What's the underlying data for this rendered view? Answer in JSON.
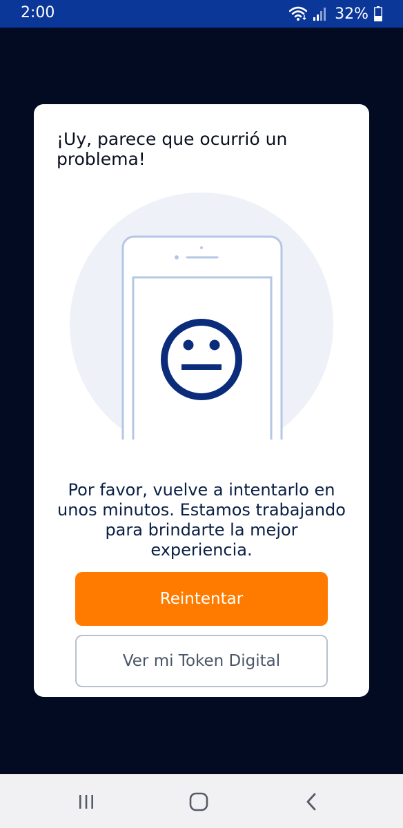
{
  "status_bar": {
    "time": "2:00",
    "battery_percent": "32%",
    "icons": [
      "wifi-icon",
      "signal-icon",
      "battery-icon"
    ]
  },
  "dialog": {
    "title": "¡Uy, parece que ocurrió un problema!",
    "illustration": "phone-neutral-face",
    "message": "Por favor, vuelve a intentarlo en unos minutos. Estamos trabajando para brindarte la mejor experiencia.",
    "primary_button": "Reintentar",
    "secondary_button": "Ver mi Token Digital"
  },
  "nav_bar": {
    "icons": [
      "recent-apps-icon",
      "home-icon",
      "back-icon"
    ]
  },
  "colors": {
    "status_bar": "#0b3799",
    "backdrop": "#030b22",
    "primary_button": "#ff7b00",
    "face": "#0a2c7a",
    "phone_outline": "#b5c6e6",
    "circle_bg": "#eef1f8"
  }
}
